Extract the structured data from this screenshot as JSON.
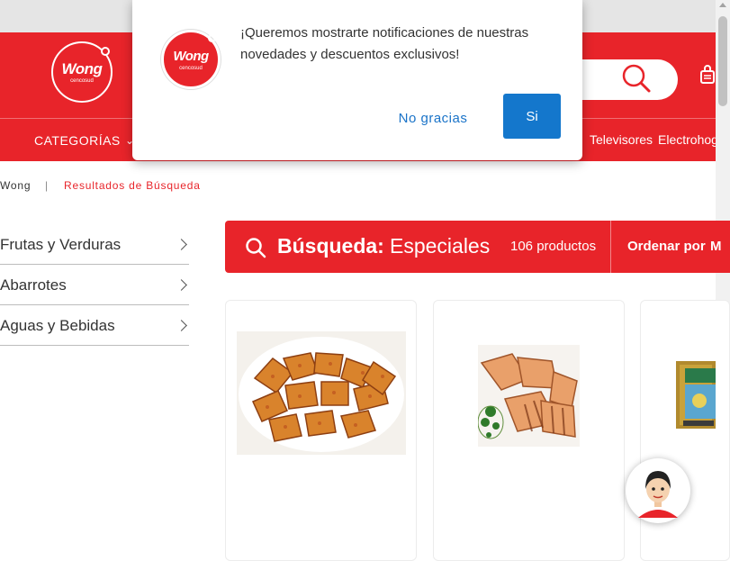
{
  "header": {
    "logo_text": "Wong",
    "logo_sub": "cencosud"
  },
  "nav": {
    "categories_label": "CATEGORÍAS",
    "links": [
      "Televisores",
      "Electrohog"
    ]
  },
  "breadcrumb": {
    "home": "Wong",
    "separator": "|",
    "current": "Resultados de Búsqueda"
  },
  "sidebar": {
    "items": [
      {
        "label": "Frutas y Verduras"
      },
      {
        "label": "Abarrotes"
      },
      {
        "label": "Aguas y Bebidas"
      }
    ]
  },
  "search_banner": {
    "label": "Búsqueda:",
    "term": "Especiales",
    "count": "106 productos",
    "sort_label": "Ordenar por",
    "sort_value_partial": "M"
  },
  "popup": {
    "logo_text": "Wong",
    "logo_sub": "cencosud",
    "message": "¡Queremos mostrarte notificaciones de nuestras novedades y descuentos exclusivos!",
    "decline_label": "No gracias",
    "accept_label": "Si"
  },
  "colors": {
    "brand_red": "#e8242a",
    "button_blue": "#1477cc",
    "link_blue": "#1a73c8"
  },
  "icons": [
    "search-icon",
    "cart-icon",
    "chevron-down-icon",
    "chevron-right-icon",
    "magnifier-icon",
    "chat-assistant-avatar"
  ]
}
